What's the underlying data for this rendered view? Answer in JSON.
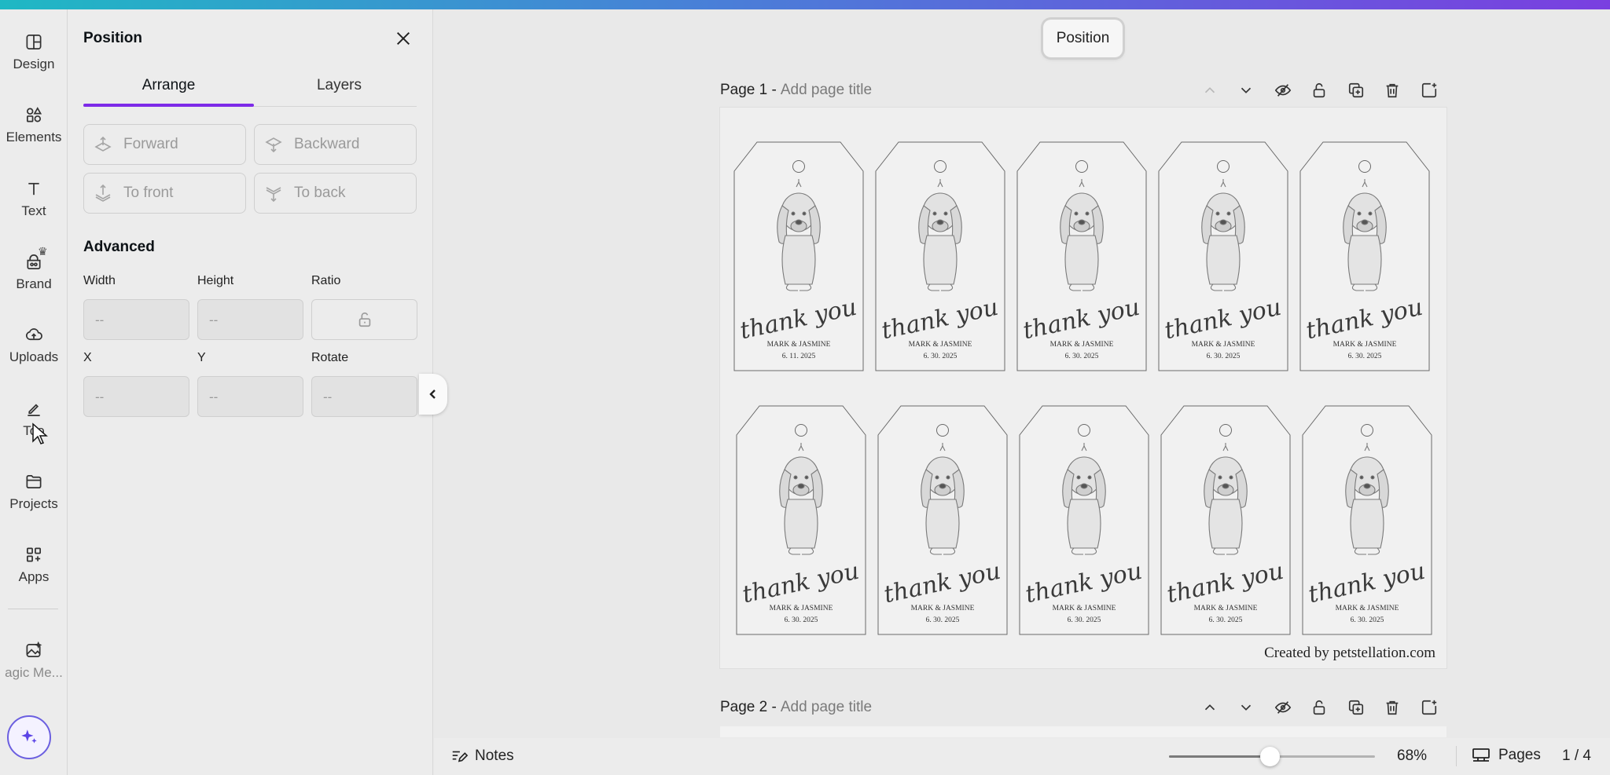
{
  "rail": {
    "items": [
      {
        "label": "Design",
        "icon": "design-icon"
      },
      {
        "label": "Elements",
        "icon": "elements-icon"
      },
      {
        "label": "Text",
        "icon": "text-icon"
      },
      {
        "label": "Brand",
        "icon": "brand-icon"
      },
      {
        "label": "Uploads",
        "icon": "uploads-icon"
      },
      {
        "label": "Tools",
        "icon": "tools-icon"
      },
      {
        "label": "Projects",
        "icon": "projects-icon"
      },
      {
        "label": "Apps",
        "icon": "apps-icon"
      },
      {
        "label": "Magic Me...",
        "icon": "magic-media-icon"
      }
    ],
    "tools_visible": "Too",
    "magic_label_visible": "agic Me..."
  },
  "panel": {
    "title": "Position",
    "tabs": [
      "Arrange",
      "Layers"
    ],
    "active_tab": "Arrange",
    "arrange_buttons": [
      "Forward",
      "Backward",
      "To front",
      "To back"
    ],
    "advanced_title": "Advanced",
    "fields": {
      "width": {
        "label": "Width",
        "value": "--"
      },
      "height": {
        "label": "Height",
        "value": "--"
      },
      "ratio": {
        "label": "Ratio"
      },
      "x": {
        "label": "X",
        "value": "--"
      },
      "y": {
        "label": "Y",
        "value": "--"
      },
      "rotate": {
        "label": "Rotate",
        "value": "--"
      }
    }
  },
  "canvas": {
    "position_chip": "Position",
    "page1": {
      "name": "Page 1 -",
      "title_placeholder": "Add page title"
    },
    "page2": {
      "name": "Page 2 -",
      "title_placeholder": "Add page title"
    },
    "tags": [
      {
        "names": "MARK & JASMINE",
        "date": "6. 11. 2025"
      },
      {
        "names": "MARK & JASMINE",
        "date": "6. 30. 2025"
      },
      {
        "names": "MARK & JASMINE",
        "date": "6. 30. 2025"
      },
      {
        "names": "MARK & JASMINE",
        "date": "6. 30. 2025"
      },
      {
        "names": "MARK & JASMINE",
        "date": "6. 30. 2025"
      },
      {
        "names": "MARK & JASMINE",
        "date": "6. 30. 2025"
      },
      {
        "names": "MARK & JASMINE",
        "date": "6. 30. 2025"
      },
      {
        "names": "MARK & JASMINE",
        "date": "6. 30. 2025"
      },
      {
        "names": "MARK & JASMINE",
        "date": "6. 30. 2025"
      },
      {
        "names": "MARK & JASMINE",
        "date": "6. 30. 2025"
      }
    ],
    "tag_script": "thank you",
    "credit": "Created by petstellation.com"
  },
  "bottombar": {
    "notes": "Notes",
    "zoom_level": "68%",
    "zoom_fraction": 0.49,
    "pages_label": "Pages",
    "page_count": "1 / 4"
  },
  "colors": {
    "accent": "#7d2ae8",
    "gradient_start": "#1fb8c4",
    "gradient_end": "#7a3fe0"
  }
}
